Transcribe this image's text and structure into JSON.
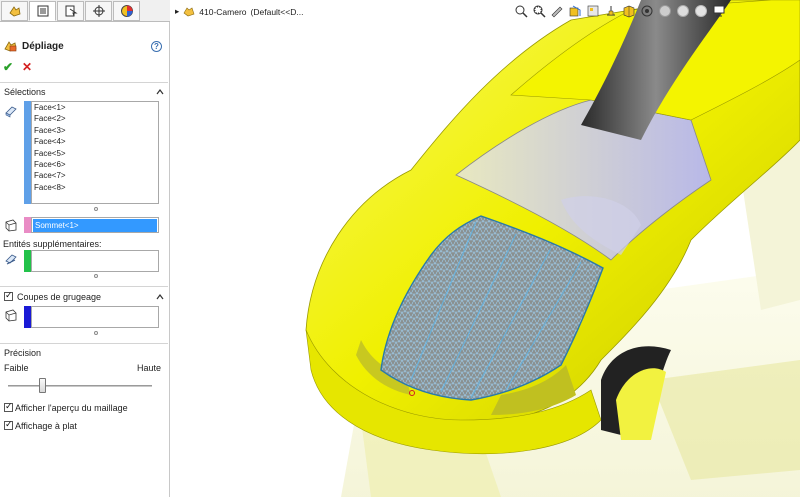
{
  "tabs": [
    {
      "name": "feature-manager",
      "icon": "feature-tree-icon"
    },
    {
      "name": "property-manager",
      "icon": "property-manager-icon"
    },
    {
      "name": "configuration-manager",
      "icon": "configuration-icon"
    },
    {
      "name": "dimxpert-manager",
      "icon": "crosshair-icon"
    },
    {
      "name": "display-manager",
      "icon": "appearance-icon"
    }
  ],
  "feature": {
    "title": "Dépliage",
    "help": "?",
    "ok": "✔",
    "cancel": "✕"
  },
  "selections": {
    "header": "Sélections",
    "faces": [
      "Face<1>",
      "Face<2>",
      "Face<3>",
      "Face<4>",
      "Face<5>",
      "Face<6>",
      "Face<7>",
      "Face<8>"
    ],
    "faces_color": "#5fa0e8",
    "vertex": "Sommet<1>",
    "vertex_color": "#e98cc5",
    "extra_label": "Entités supplémentaires:",
    "extra_color": "#22c24a"
  },
  "relief": {
    "header": "Coupes de grugeage",
    "checked": true,
    "color": "#1a1ad6"
  },
  "precision": {
    "header": "Précision",
    "low": "Faible",
    "high": "Haute",
    "level": 0.24
  },
  "options": {
    "mesh_preview": "Afficher l'aperçu du maillage",
    "mesh_preview_checked": true,
    "flat_display": "Affichage à plat",
    "flat_display_checked": true
  },
  "breadcrumb": {
    "part": "410-Camero",
    "config": "(Default<<D..."
  },
  "toolbar_icons": [
    "zoom-fit-icon",
    "zoom-area-icon",
    "previous-view-icon",
    "section-view-icon",
    "dynamic-annotation-icon",
    "view-orientation-icon",
    "display-style-icon",
    "hide-show-icon",
    "edit-appearance-icon",
    "apply-scene-icon",
    "view-settings-icon",
    "monitor-icon"
  ],
  "colors": {
    "car_body": "#f2f20a",
    "stripe": "#3c3c3c",
    "mesh": "#7fb6d6"
  }
}
